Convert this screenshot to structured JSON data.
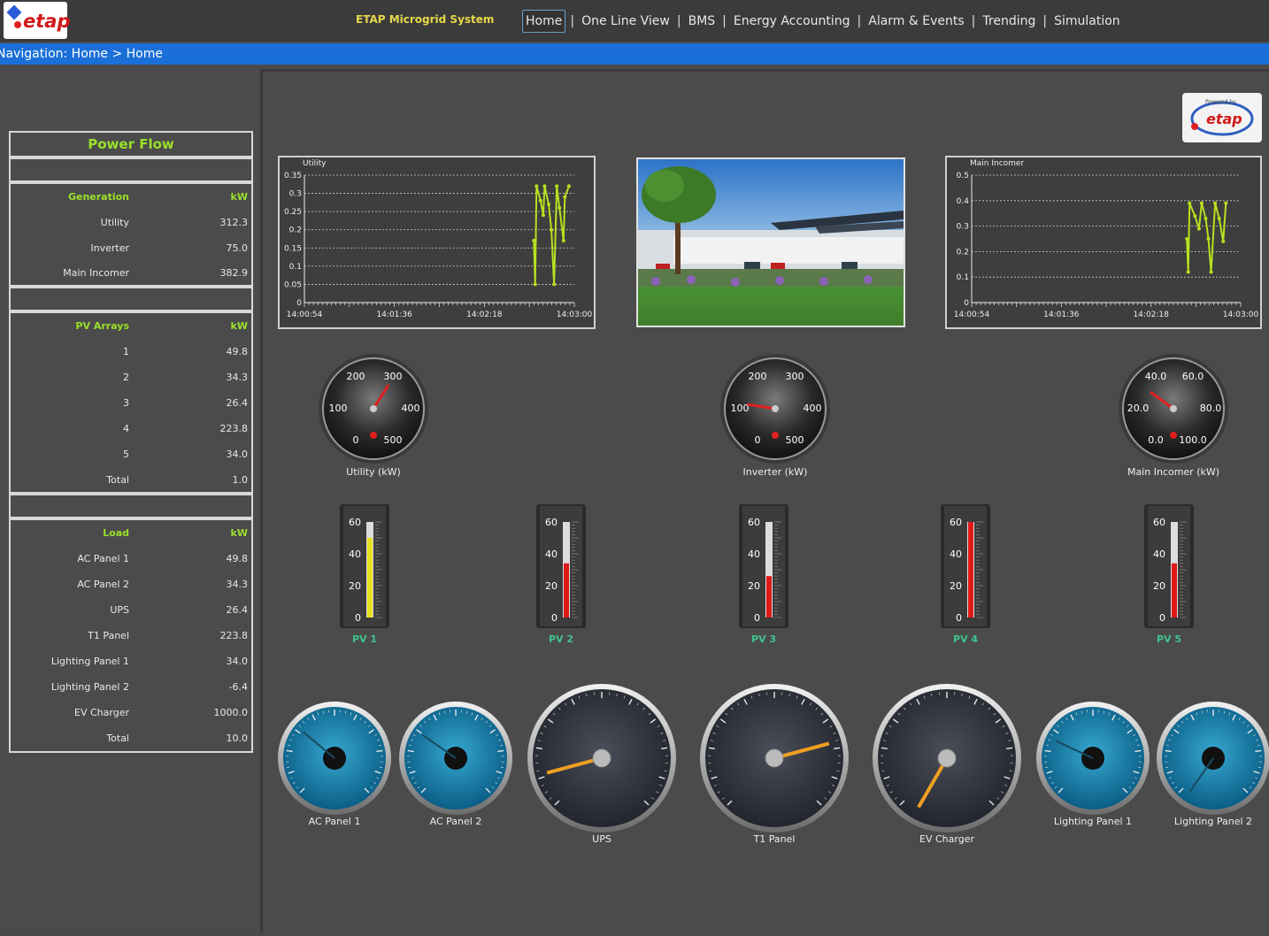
{
  "app": {
    "title": "ETAP Microgrid System",
    "logo_text": "etap",
    "badge_text": "etap",
    "badge_small": "Powered by"
  },
  "topnav": [
    {
      "label": "Home",
      "active": true
    },
    {
      "label": "One Line View"
    },
    {
      "label": "BMS"
    },
    {
      "label": "Energy Accounting"
    },
    {
      "label": "Alarm & Events"
    },
    {
      "label": "Trending"
    },
    {
      "label": "Simulation"
    }
  ],
  "topnav_separator": "|",
  "navigation": "Navigation: Home > Home",
  "power_flow": {
    "title": "Power Flow",
    "generation": {
      "header": "Generation",
      "unit": "kW",
      "rows": [
        {
          "label": "Utility",
          "value": "312.3"
        },
        {
          "label": "Inverter",
          "value": "75.0"
        },
        {
          "label": "Main Incomer",
          "value": "382.9"
        }
      ]
    },
    "pv_arrays": {
      "header": "PV Arrays",
      "unit": "kW",
      "rows": [
        {
          "label": "1",
          "value": "49.8"
        },
        {
          "label": "2",
          "value": "34.3"
        },
        {
          "label": "3",
          "value": "26.4"
        },
        {
          "label": "4",
          "value": "223.8"
        },
        {
          "label": "5",
          "value": "34.0"
        },
        {
          "label": "Total",
          "value": "1.0"
        }
      ]
    },
    "load": {
      "header": "Load",
      "unit": "kW",
      "rows": [
        {
          "label": "AC Panel 1",
          "value": "49.8"
        },
        {
          "label": "AC Panel 2",
          "value": "34.3"
        },
        {
          "label": "UPS",
          "value": "26.4"
        },
        {
          "label": "T1 Panel",
          "value": "223.8"
        },
        {
          "label": "Lighting Panel 1",
          "value": "34.0"
        },
        {
          "label": "Lighting Panel 2",
          "value": "-6.4"
        },
        {
          "label": "EV Charger",
          "value": "1000.0"
        },
        {
          "label": "Total",
          "value": "10.0"
        }
      ]
    }
  },
  "chart_data": [
    {
      "type": "line",
      "title": "Utility",
      "ylim": [
        0,
        0.35
      ],
      "yticks": [
        "0",
        "0.05",
        "0.1",
        "0.15",
        "0.2",
        "0.25",
        "0.3",
        "0.35"
      ],
      "xticks": [
        "14:00:54",
        "14:01:36",
        "14:02:18",
        "14:03:00"
      ],
      "grid": true,
      "series": [
        {
          "color": "#b8e020",
          "x": [
            0.85,
            0.855,
            0.86,
            0.875,
            0.885,
            0.89,
            0.905,
            0.915,
            0.925,
            0.935,
            0.945,
            0.96,
            0.965,
            0.98
          ],
          "values": [
            0.17,
            0.05,
            0.32,
            0.28,
            0.24,
            0.32,
            0.27,
            0.2,
            0.05,
            0.32,
            0.26,
            0.17,
            0.29,
            0.32
          ]
        }
      ]
    },
    {
      "type": "line",
      "title": "Main Incomer",
      "ylim": [
        0,
        0.5
      ],
      "yticks": [
        "0",
        "0.1",
        "0.2",
        "0.3",
        "0.4",
        "0.5"
      ],
      "xticks": [
        "14:00:54",
        "14:01:36",
        "14:02:18",
        "14:03:00"
      ],
      "grid": true,
      "series": [
        {
          "color": "#b8e020",
          "x": [
            0.8,
            0.805,
            0.81,
            0.83,
            0.845,
            0.855,
            0.87,
            0.88,
            0.89,
            0.905,
            0.92,
            0.935,
            0.945
          ],
          "values": [
            0.25,
            0.12,
            0.39,
            0.34,
            0.29,
            0.39,
            0.33,
            0.25,
            0.12,
            0.39,
            0.33,
            0.24,
            0.39
          ]
        }
      ]
    }
  ],
  "top_gauges": [
    {
      "label": "Utility (kW)",
      "ticks": [
        "0",
        "100",
        "200",
        "300",
        "400",
        "500"
      ],
      "value_fraction": 0.62
    },
    {
      "label": "Inverter (kW)",
      "ticks": [
        "0",
        "100",
        "200",
        "300",
        "400",
        "500"
      ],
      "value_fraction": 0.2
    },
    {
      "label": "Main Incomer (kW)",
      "ticks": [
        "0.0",
        "20.0",
        "40.0",
        "60.0",
        "80.0",
        "100.0"
      ],
      "value_fraction": 0.3
    }
  ],
  "pv_bars": [
    {
      "label": "PV 1",
      "value": 50,
      "color": "#e8e020"
    },
    {
      "label": "PV 2",
      "value": 34,
      "color": "#e01818"
    },
    {
      "label": "PV 3",
      "value": 26,
      "color": "#e01818"
    },
    {
      "label": "PV 4",
      "value": 60,
      "color": "#e01818"
    },
    {
      "label": "PV 5",
      "value": 34,
      "color": "#e01818"
    }
  ],
  "pv_ticks": [
    "0",
    "20",
    "40",
    "60"
  ],
  "load_gauges": [
    {
      "label": "AC Panel 1",
      "style": "blue"
    },
    {
      "label": "AC Panel 2",
      "style": "blue"
    },
    {
      "label": "UPS",
      "style": "dark"
    },
    {
      "label": "T1 Panel",
      "style": "dark"
    },
    {
      "label": "EV Charger",
      "style": "dark"
    },
    {
      "label": "Lighting Panel 1",
      "style": "blue"
    },
    {
      "label": "Lighting Panel 2",
      "style": "blue"
    }
  ]
}
